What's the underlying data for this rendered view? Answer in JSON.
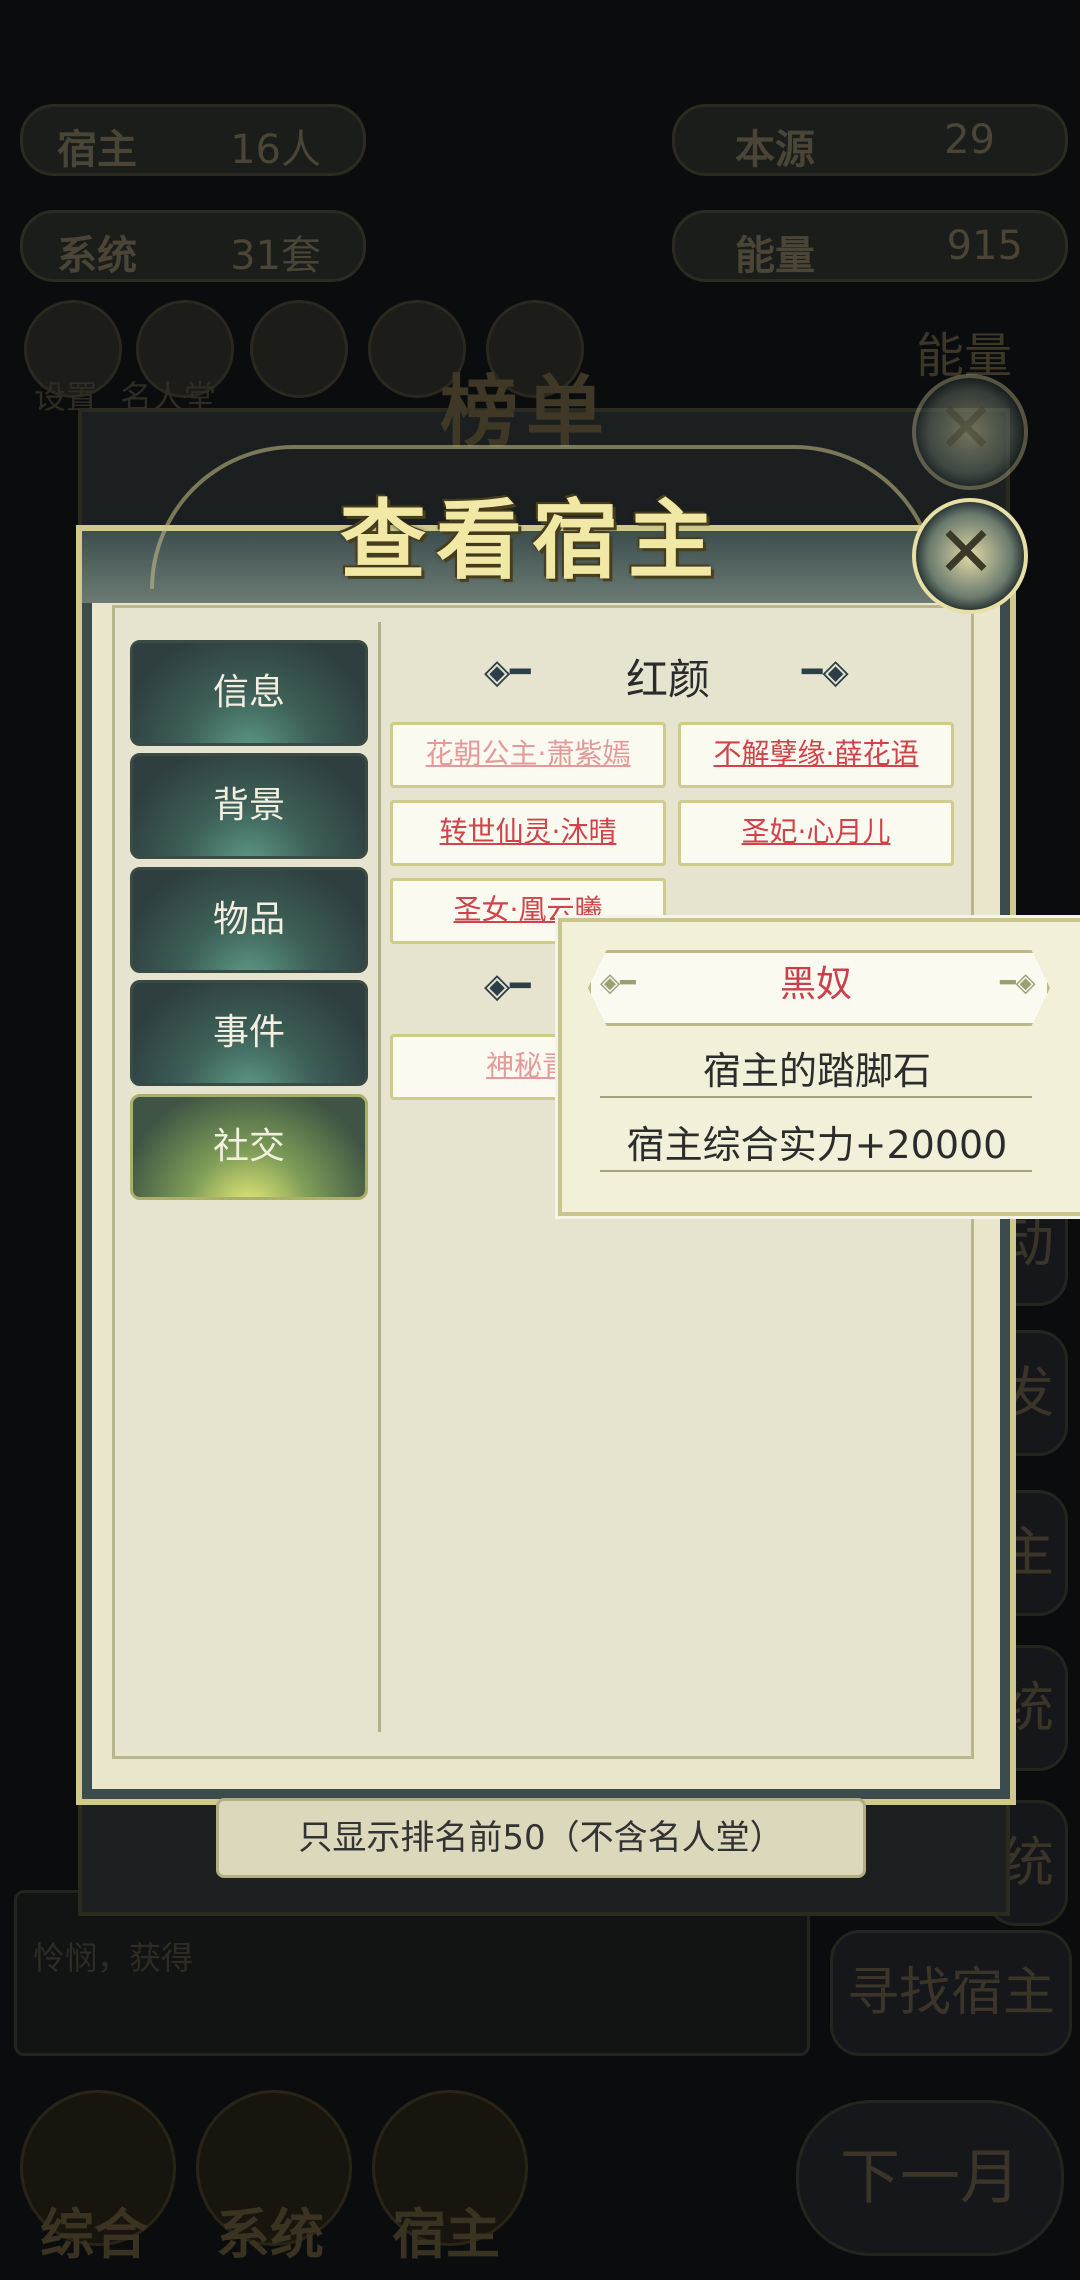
{
  "background": {
    "stats": [
      {
        "label": "宿主",
        "value": "16人"
      },
      {
        "label": "本源",
        "value": "29"
      },
      {
        "label": "系统",
        "value": "31套"
      },
      {
        "label": "能量",
        "value": "915"
      }
    ],
    "menu_labels": [
      "设置",
      "名人堂"
    ],
    "side_energy": "能量",
    "right_buttons": [
      "动",
      "发",
      "主",
      "统",
      "统"
    ],
    "find_host": "寻找宿主",
    "nav": [
      "综合",
      "系统",
      "宿主"
    ],
    "next_month": "下一月",
    "log_fragment": "怜悯，获得"
  },
  "back_panel": {
    "title": "榜单"
  },
  "panel": {
    "title": "查看宿主",
    "tabs": [
      "信息",
      "背景",
      "物品",
      "事件",
      "社交"
    ],
    "active_tab": "社交",
    "section1": "红颜",
    "relations1": [
      {
        "text": "花朝公主·萧紫嫣",
        "style": "dim"
      },
      {
        "text": "不解孽缘·薛花语",
        "style": "red"
      },
      {
        "text": "转世仙灵·沐晴",
        "style": "red"
      },
      {
        "text": "圣妃·心月儿",
        "style": "red"
      },
      {
        "text": "圣女·凰云曦",
        "style": "red"
      }
    ],
    "relation2_partial": "神秘青"
  },
  "tooltip": {
    "title": "黑奴",
    "line1": "宿主的踏脚石",
    "line2": "宿主综合实力+20000"
  },
  "notice": "只显示排名前50（不含名人堂）",
  "colors": {
    "accent_red": "#d2424a",
    "panel_bg": "#e9e6cc",
    "tab_green": "#3d5f57"
  }
}
